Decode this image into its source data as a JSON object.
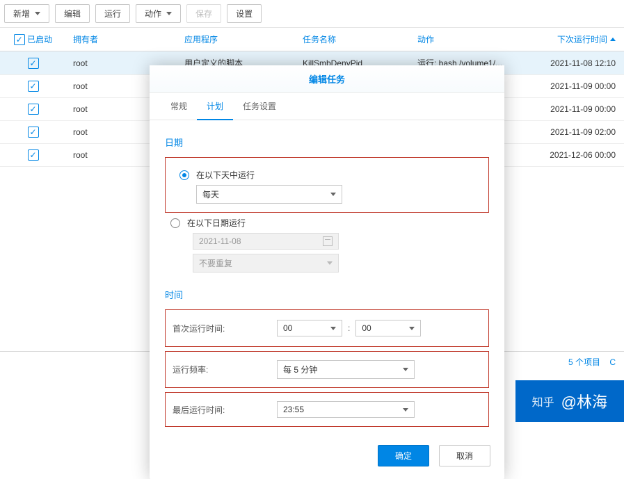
{
  "toolbar": {
    "add": "新增",
    "edit": "编辑",
    "run": "运行",
    "actions": "动作",
    "save": "保存",
    "settings": "设置"
  },
  "columns": {
    "enabled": "已启动",
    "owner": "拥有者",
    "app": "应用程序",
    "task": "任务名称",
    "action": "动作",
    "next": "下次运行时间"
  },
  "rows": [
    {
      "owner": "root",
      "app": "用户定义的脚本",
      "task": "KillSmbDenyPid",
      "action": "运行: bash /volume1/...",
      "next": "2021-11-08 12:10"
    },
    {
      "owner": "root",
      "app": "",
      "task": "",
      "action": "",
      "next": "2021-11-09 00:00"
    },
    {
      "owner": "root",
      "app": "",
      "task": "",
      "action": "",
      "next": "2021-11-09 00:00"
    },
    {
      "owner": "root",
      "app": "",
      "task": "",
      "action": "",
      "next": "2021-11-09 02:00"
    },
    {
      "owner": "root",
      "app": "",
      "task": "",
      "action": "",
      "next": "2021-12-06 00:00"
    }
  ],
  "footer": {
    "count": "5 个项目",
    "refresh": "C"
  },
  "modal": {
    "title": "编辑任务",
    "tabs": {
      "general": "常规",
      "schedule": "计划",
      "settings": "任务设置"
    },
    "date_section": "日期",
    "run_on_days": "在以下天中运行",
    "daily": "每天",
    "run_on_date": "在以下日期运行",
    "date_value": "2021-11-08",
    "no_repeat": "不要重复",
    "time_section": "时间",
    "first_run": "首次运行时间:",
    "hour": "00",
    "minute": "00",
    "frequency_label": "运行频率:",
    "frequency_value": "每 5 分钟",
    "last_run_label": "最后运行时间:",
    "last_run_value": "23:55",
    "ok": "确定",
    "cancel": "取消"
  },
  "watermark": {
    "logo": "知乎",
    "author": "@林海"
  }
}
